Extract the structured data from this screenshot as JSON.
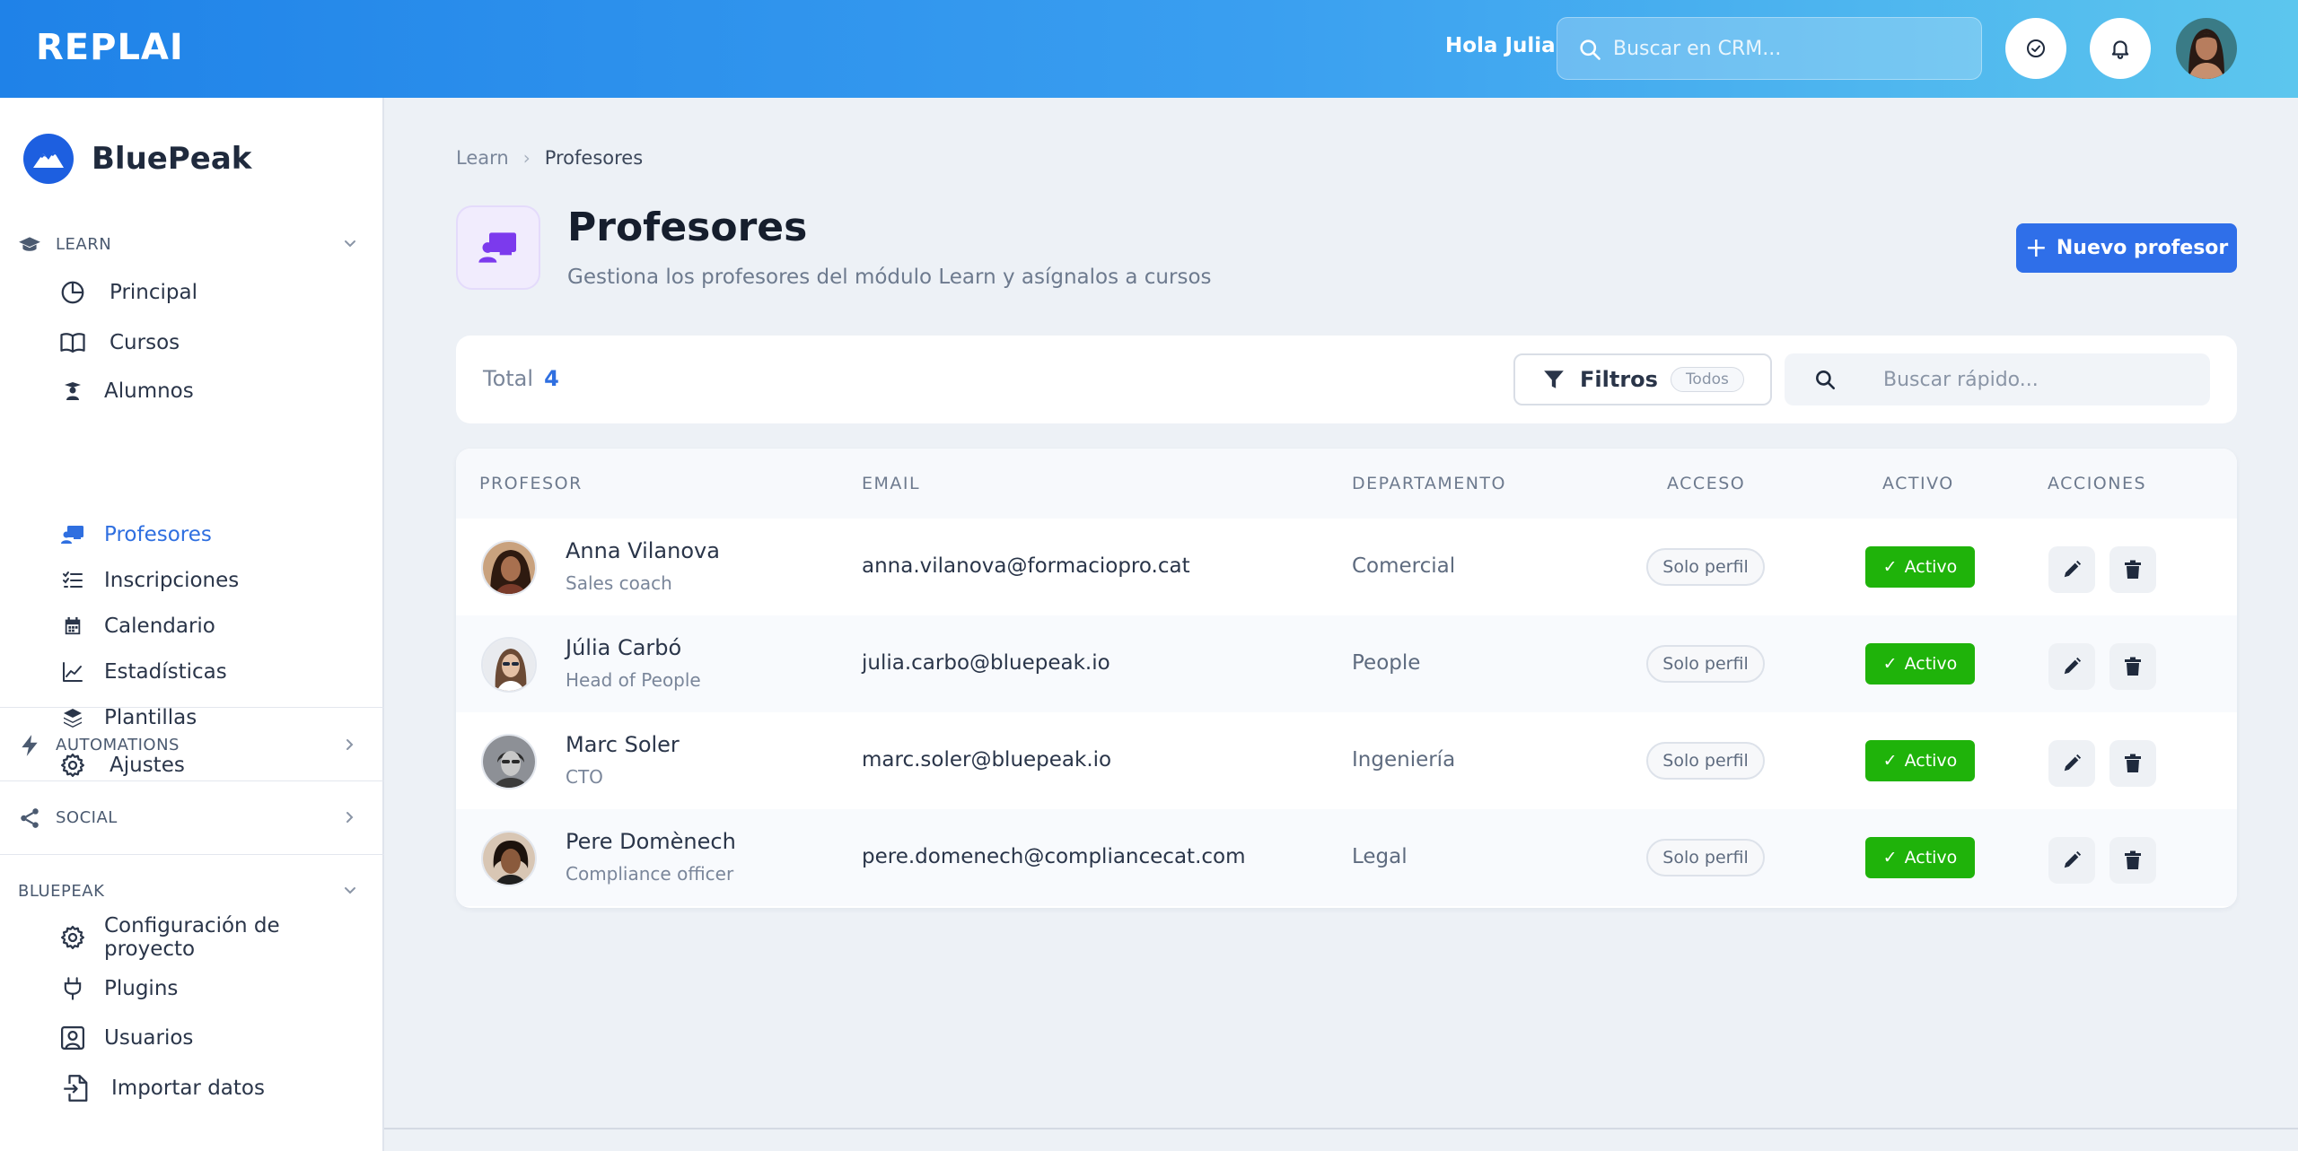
{
  "topbar": {
    "logo": "REPLAI",
    "greeting": "Hola Julia",
    "search_placeholder": "Buscar en CRM..."
  },
  "sidebar": {
    "brand": "BluePeak",
    "sections": {
      "learn": "LEARN",
      "automations": "AUTOMATIONS",
      "social": "SOCIAL",
      "bluepeak": "BLUEPEAK"
    },
    "learn_items": [
      {
        "label": "Principal",
        "icon": "pie-chart-icon"
      },
      {
        "label": "Cursos",
        "icon": "book-icon"
      },
      {
        "label": "Alumnos",
        "icon": "student-icon"
      },
      {
        "label": "Profesores",
        "icon": "teacher-icon",
        "active": true
      },
      {
        "label": "Inscripciones",
        "icon": "list-check-icon"
      },
      {
        "label": "Calendario",
        "icon": "calendar-icon"
      },
      {
        "label": "Estadísticas",
        "icon": "line-chart-icon"
      },
      {
        "label": "Plantillas",
        "icon": "layers-icon"
      },
      {
        "label": "Ajustes",
        "icon": "gear-icon"
      }
    ],
    "bluepeak_items": [
      {
        "label": "Configuración de proyecto",
        "icon": "gear-icon"
      },
      {
        "label": "Plugins",
        "icon": "plug-icon"
      },
      {
        "label": "Usuarios",
        "icon": "user-square-icon"
      },
      {
        "label": "Importar datos",
        "icon": "file-import-icon"
      }
    ]
  },
  "breadcrumb": {
    "parent": "Learn",
    "current": "Profesores"
  },
  "page": {
    "title": "Profesores",
    "subtitle": "Gestiona los profesores del módulo Learn y asígnalos a cursos",
    "new_button": "Nuevo profesor"
  },
  "filters": {
    "total_label": "Total",
    "total_value": "4",
    "filter_label": "Filtros",
    "filter_badge": "Todos",
    "quick_search_placeholder": "Buscar rápido..."
  },
  "table": {
    "headers": {
      "profesor": "PROFESOR",
      "email": "EMAIL",
      "departamento": "DEPARTAMENTO",
      "acceso": "ACCESO",
      "activo": "ACTIVO",
      "acciones": "ACCIONES"
    },
    "rows": [
      {
        "name": "Anna Vilanova",
        "role": "Sales coach",
        "email": "anna.vilanova@formaciopro.cat",
        "department": "Comercial",
        "access": "Solo perfil",
        "active": "Activo"
      },
      {
        "name": "Júlia Carbó",
        "role": "Head of People",
        "email": "julia.carbo@bluepeak.io",
        "department": "People",
        "access": "Solo perfil",
        "active": "Activo"
      },
      {
        "name": "Marc Soler",
        "role": "CTO",
        "email": "marc.soler@bluepeak.io",
        "department": "Ingeniería",
        "access": "Solo perfil",
        "active": "Activo"
      },
      {
        "name": "Pere Domènech",
        "role": "Compliance officer",
        "email": "pere.domenech@compliancecat.com",
        "department": "Legal",
        "access": "Solo perfil",
        "active": "Activo"
      }
    ]
  },
  "colors": {
    "accent": "#2f6fe9",
    "active_green": "#1fb30a",
    "topbar_start": "#1f82e8",
    "topbar_end": "#5cc6ee"
  }
}
